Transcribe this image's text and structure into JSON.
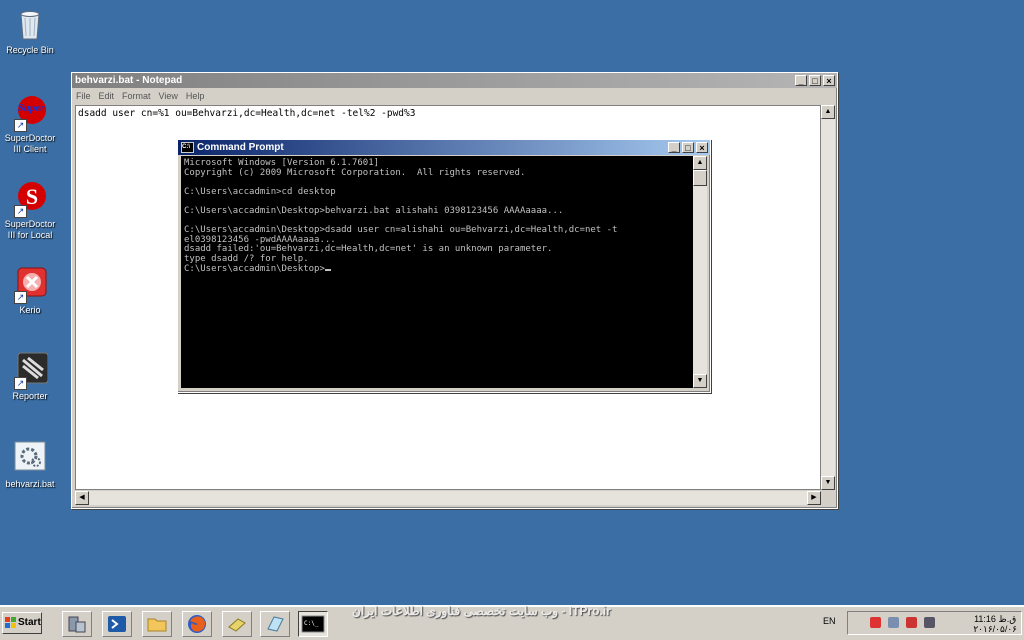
{
  "desktop": {
    "icons": [
      {
        "label": "Recycle Bin",
        "icon": "recycle-bin-icon"
      },
      {
        "label": "SuperDoctor III Client",
        "icon": "superdoctor-icon",
        "logo_text": "Super"
      },
      {
        "label": "SuperDoctor III for Local",
        "icon": "superdoctor-local-icon",
        "logo_text": "S"
      },
      {
        "label": "Kerio",
        "icon": "kerio-icon"
      },
      {
        "label": "Reporter",
        "icon": "reporter-icon"
      },
      {
        "label": "behvarzi.bat",
        "icon": "batch-file-icon"
      }
    ]
  },
  "notepad": {
    "title": "behvarzi.bat - Notepad",
    "menu": [
      "File",
      "Edit",
      "Format",
      "View",
      "Help"
    ],
    "content": "dsadd user cn=%1 ou=Behvarzi,dc=Health,dc=net -tel%2 -pwd%3"
  },
  "cmd": {
    "title": "Command Prompt",
    "lines": [
      "Microsoft Windows [Version 6.1.7601]",
      "Copyright (c) 2009 Microsoft Corporation.  All rights reserved.",
      "",
      "C:\\Users\\accadmin>cd desktop",
      "",
      "C:\\Users\\accadmin\\Desktop>behvarzi.bat alishahi 0398123456 AAAAaaaa...",
      "",
      "C:\\Users\\accadmin\\Desktop>dsadd user cn=alishahi ou=Behvarzi,dc=Health,dc=net -t",
      "el0398123456 -pwdAAAAaaaa...",
      "dsadd failed:'ou=Behvarzi,dc=Health,dc=net' is an unknown parameter.",
      "type dsadd /? for help."
    ],
    "prompt": "C:\\Users\\accadmin\\Desktop>"
  },
  "taskbar": {
    "start_label": "Start",
    "language": "EN",
    "clock_time": "11:16 ق.ظ",
    "clock_date": "۲۰۱۶/۰۵/۰۶",
    "watermark": "وب سایت تخصصی فناوری اطلاعات ایران - ITPro.ir"
  },
  "colors": {
    "desktop": "#3a6ea5",
    "active_title": "#0a246a",
    "inactive_title": "#808080",
    "console_text": "#c0c0c0"
  }
}
